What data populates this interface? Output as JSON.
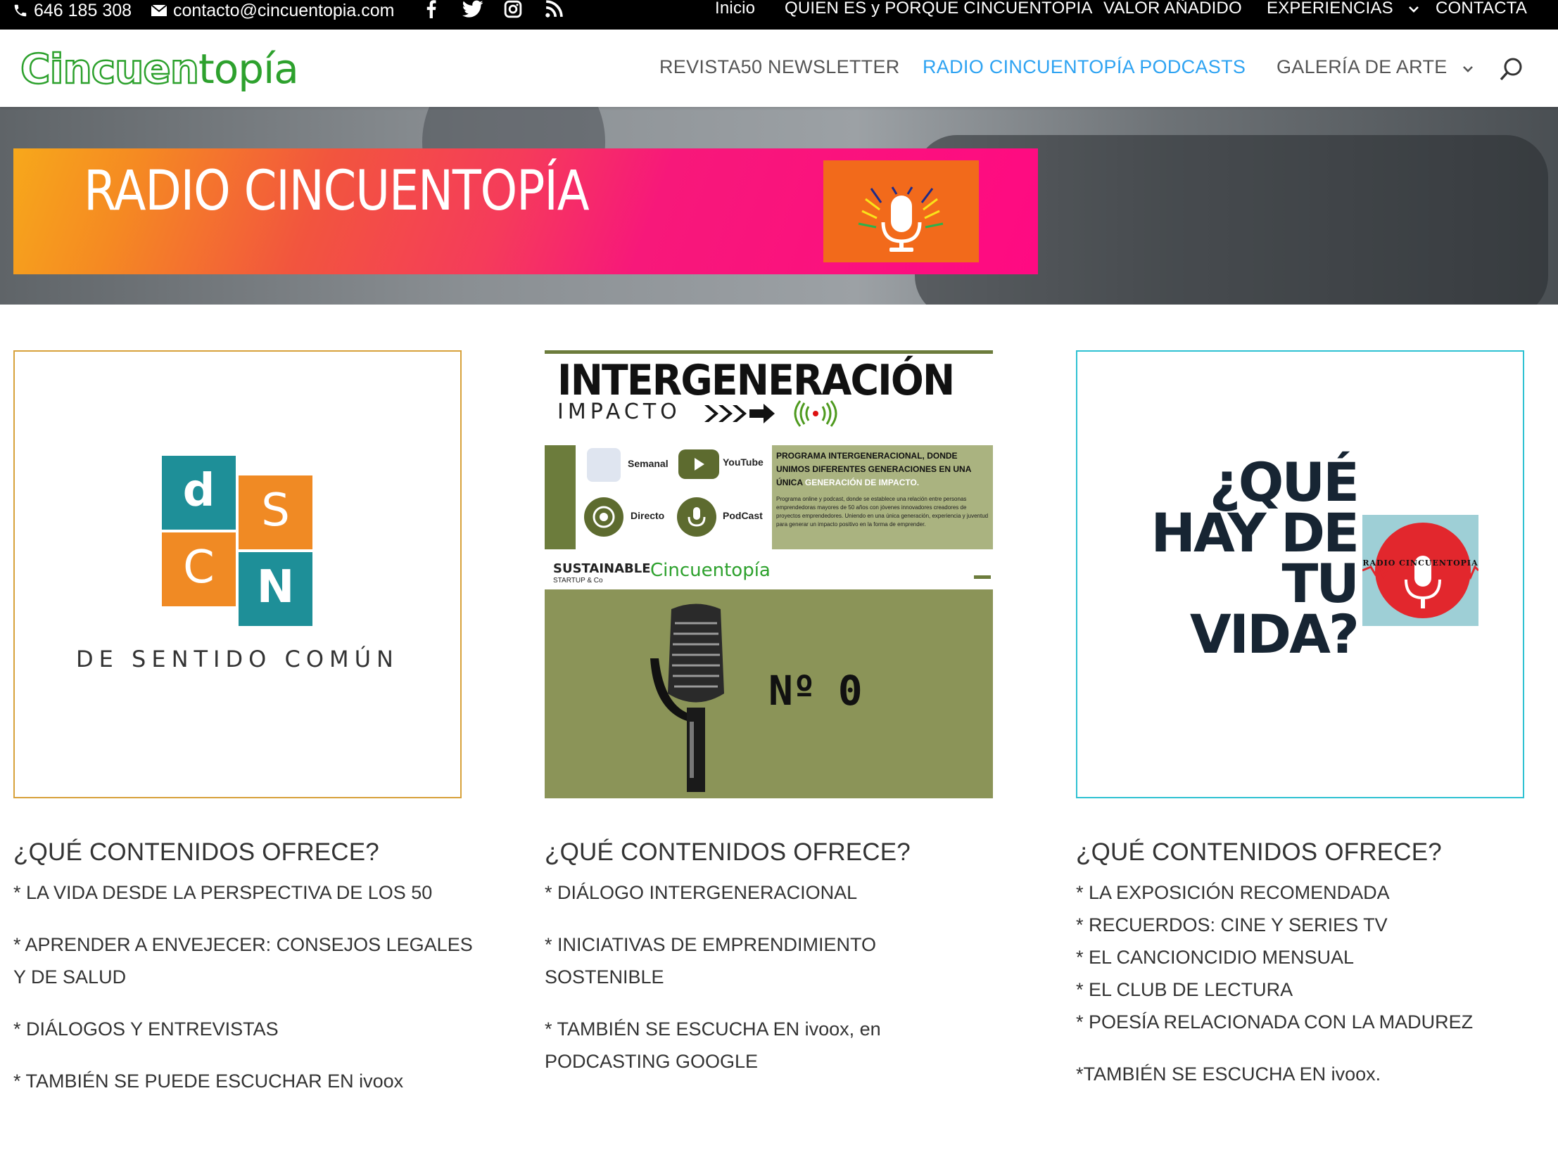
{
  "topbar": {
    "phone": "646 185 308",
    "email": "contacto@cincuentopia.com",
    "social_icons": [
      "facebook-icon",
      "twitter-icon",
      "instagram-icon",
      "rss-icon"
    ],
    "nav": [
      "Inicio",
      "QUIEN ES y PORQUE CINCUENTOPIA",
      "VALOR AÑADIDO",
      "EXPERIENCIAS",
      "CONTACTA"
    ]
  },
  "header": {
    "logo_part1": "Cincuen",
    "logo_part2": "topía",
    "nav": [
      "REVISTA50 NEWSLETTER",
      "RADIO CINCUENTOPÍA PODCASTS",
      "GALERÍA DE ARTE"
    ],
    "active_nav": "RADIO CINCUENTOPÍA PODCASTS"
  },
  "hero": {
    "banner_title": "RADIO CINCUENTOPÍA"
  },
  "cards": {
    "dsc": {
      "letters": [
        "d",
        "S",
        "C",
        "N"
      ],
      "caption": "DE SENTIDO COMÚN"
    },
    "intergen": {
      "title": "INTERGENERACIÓN",
      "subtitle": "IMPACTO",
      "items": [
        "Semanal",
        "YouTube",
        "Directo",
        "PodCast"
      ],
      "program_title_a": "PROGRAMA INTERGENERACIONAL, DONDE UNIMOS DIFERENTES GENERACIONES EN UNA ÚNICA",
      "program_title_b": "GENERACIÓN DE IMPACTO.",
      "program_body": "Programa online y podcast, donde se establece una relación entre personas emprendedoras mayores de 50 años con jóvenes innovadores creadores de proyectos emprendedores. Uniendo en una única generación, experiencia y juventud para generar un impacto positivo en la forma de emprender.",
      "sustainable": "SUSTAINABLE",
      "sustainable_sub": "STARTUP & Co",
      "brand": "Cincuentopía",
      "episode": "Nº 0"
    },
    "quehay": {
      "lines": [
        "¿QUÉ",
        "HAY DE",
        "TU",
        "VIDA?"
      ],
      "badge_text": "RADIO CINCUENTOPIA"
    }
  },
  "columns": [
    {
      "heading": "¿QUÉ CONTENIDOS OFRECE?",
      "items": [
        "* LA VIDA DESDE LA PERSPECTIVA DE LOS 50",
        "* APRENDER A ENVEJECER: CONSEJOS LEGALES Y DE SALUD",
        "* DIÁLOGOS Y ENTREVISTAS",
        "* TAMBIÉN SE PUEDE ESCUCHAR EN ivoox"
      ]
    },
    {
      "heading": "¿QUÉ CONTENIDOS OFRECE?",
      "items": [
        "* DIÁLOGO INTERGENERACIONAL",
        "* INICIATIVAS DE EMPRENDIMIENTO SOSTENIBLE",
        "* TAMBIÉN SE ESCUCHA EN ivoox, en PODCASTING GOOGLE"
      ]
    },
    {
      "heading": "¿QUÉ CONTENIDOS OFRECE?",
      "items": [
        "* LA EXPOSICIÓN RECOMENDADA",
        "* RECUERDOS: CINE Y SERIES TV",
        "* EL CANCIONCIDIO MENSUAL",
        "* EL CLUB DE LECTURA",
        "* POESÍA RELACIONADA CON LA MADUREZ",
        "*TAMBIÉN SE ESCUCHA EN ivoox."
      ]
    }
  ]
}
